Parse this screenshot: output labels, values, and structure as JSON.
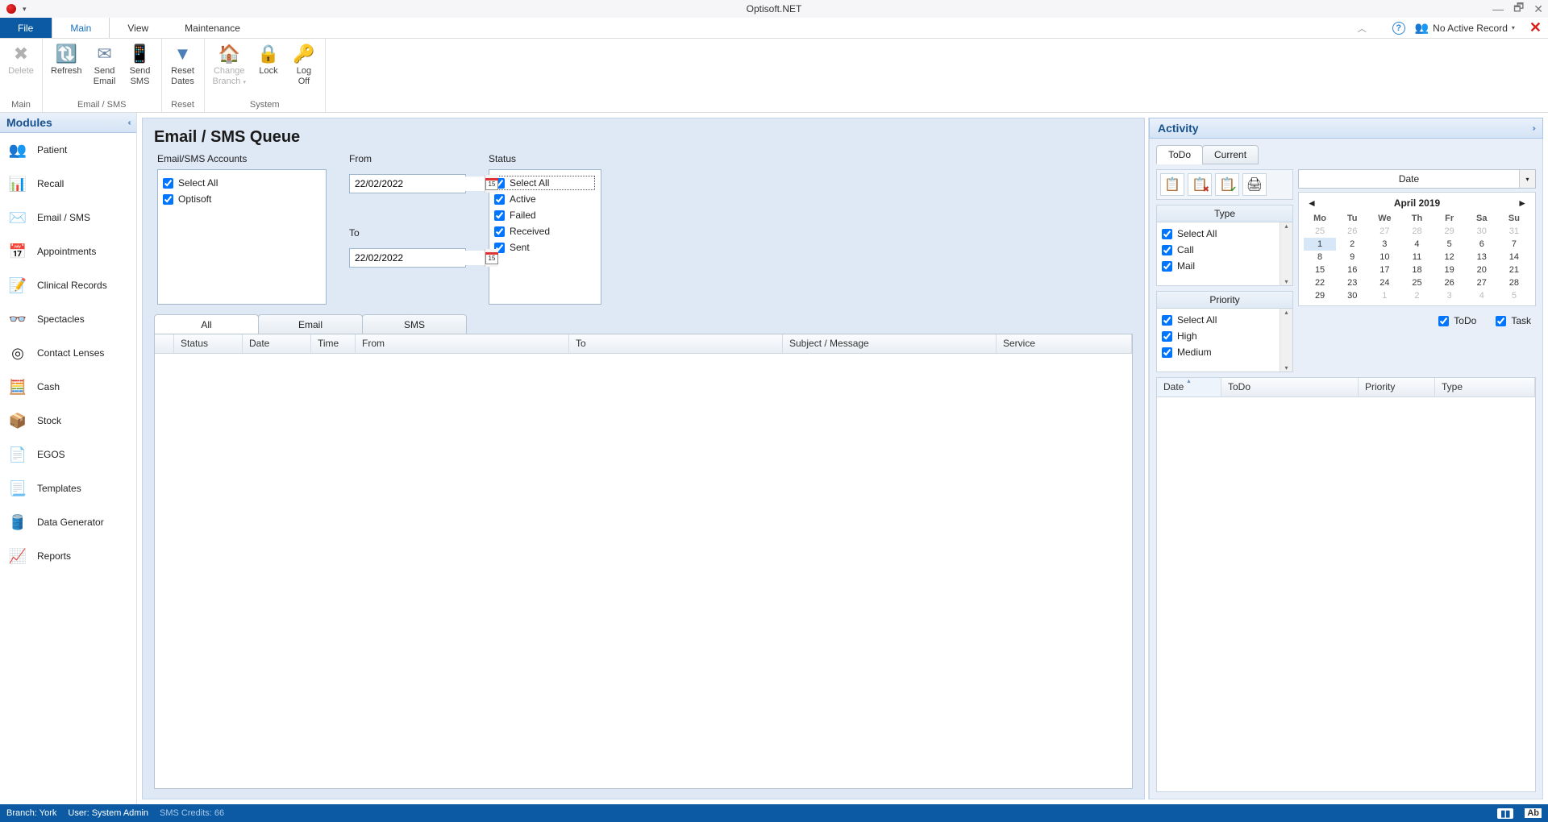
{
  "window": {
    "title": "Optisoft.NET"
  },
  "menu": {
    "file": "File",
    "main": "Main",
    "view": "View",
    "maintenance": "Maintenance",
    "no_active": "No Active Record"
  },
  "ribbon": {
    "groups": {
      "main": "Main",
      "emailsms": "Email / SMS",
      "reset": "Reset",
      "system": "System"
    },
    "delete": "Delete",
    "refresh": "Refresh",
    "send_email": "Send\nEmail",
    "send_sms": "Send\nSMS",
    "reset_dates": "Reset\nDates",
    "change_branch": "Change\nBranch",
    "lock": "Lock",
    "log_off": "Log\nOff"
  },
  "sidebar": {
    "title": "Modules",
    "items": [
      {
        "label": "Patient"
      },
      {
        "label": "Recall"
      },
      {
        "label": "Email / SMS"
      },
      {
        "label": "Appointments"
      },
      {
        "label": "Clinical Records"
      },
      {
        "label": "Spectacles"
      },
      {
        "label": "Contact Lenses"
      },
      {
        "label": "Cash"
      },
      {
        "label": "Stock"
      },
      {
        "label": "EGOS"
      },
      {
        "label": "Templates"
      },
      {
        "label": "Data Generator"
      },
      {
        "label": "Reports"
      }
    ]
  },
  "main": {
    "title": "Email / SMS Queue",
    "accounts_label": "Email/SMS Accounts",
    "accounts": {
      "select_all": "Select All",
      "optisoft": "Optisoft"
    },
    "from_label": "From",
    "to_label": "To",
    "from_value": "22/02/2022",
    "to_value": "22/02/2022",
    "cal_day": "15",
    "status_label": "Status",
    "status": {
      "select_all": "Select All",
      "active": "Active",
      "failed": "Failed",
      "received": "Received",
      "sent": "Sent"
    },
    "tabs": {
      "all": "All",
      "email": "Email",
      "sms": "SMS"
    },
    "columns": {
      "status": "Status",
      "date": "Date",
      "time": "Time",
      "from": "From",
      "to": "To",
      "subject": "Subject / Message",
      "service": "Service"
    }
  },
  "activity": {
    "title": "Activity",
    "tabs": {
      "todo": "ToDo",
      "current": "Current"
    },
    "type_title": "Type",
    "type": {
      "select_all": "Select All",
      "call": "Call",
      "mail": "Mail"
    },
    "priority_title": "Priority",
    "priority": {
      "select_all": "Select All",
      "high": "High",
      "medium": "Medium"
    },
    "date_combo": "Date",
    "cal": {
      "month": "April 2019",
      "dow": [
        "Mo",
        "Tu",
        "We",
        "Th",
        "Fr",
        "Sa",
        "Su"
      ],
      "weeks": [
        [
          {
            "d": "25",
            "o": 1
          },
          {
            "d": "26",
            "o": 1
          },
          {
            "d": "27",
            "o": 1
          },
          {
            "d": "28",
            "o": 1
          },
          {
            "d": "29",
            "o": 1
          },
          {
            "d": "30",
            "o": 1
          },
          {
            "d": "31",
            "o": 1
          }
        ],
        [
          {
            "d": "1",
            "sel": 1
          },
          {
            "d": "2"
          },
          {
            "d": "3"
          },
          {
            "d": "4"
          },
          {
            "d": "5"
          },
          {
            "d": "6"
          },
          {
            "d": "7"
          }
        ],
        [
          {
            "d": "8"
          },
          {
            "d": "9"
          },
          {
            "d": "10"
          },
          {
            "d": "11"
          },
          {
            "d": "12"
          },
          {
            "d": "13"
          },
          {
            "d": "14"
          }
        ],
        [
          {
            "d": "15"
          },
          {
            "d": "16"
          },
          {
            "d": "17"
          },
          {
            "d": "18"
          },
          {
            "d": "19"
          },
          {
            "d": "20"
          },
          {
            "d": "21"
          }
        ],
        [
          {
            "d": "22"
          },
          {
            "d": "23"
          },
          {
            "d": "24"
          },
          {
            "d": "25"
          },
          {
            "d": "26"
          },
          {
            "d": "27"
          },
          {
            "d": "28"
          }
        ],
        [
          {
            "d": "29"
          },
          {
            "d": "30"
          },
          {
            "d": "1",
            "o": 1
          },
          {
            "d": "2",
            "o": 1
          },
          {
            "d": "3",
            "o": 1
          },
          {
            "d": "4",
            "o": 1
          },
          {
            "d": "5",
            "o": 1
          }
        ]
      ]
    },
    "checks": {
      "todo": "ToDo",
      "task": "Task"
    },
    "grid_cols": {
      "date": "Date",
      "todo": "ToDo",
      "priority": "Priority",
      "type": "Type"
    }
  },
  "status": {
    "branch": "Branch: York",
    "user": "User: System Admin",
    "credits": "SMS Credits: 66",
    "ab": "Ab"
  }
}
